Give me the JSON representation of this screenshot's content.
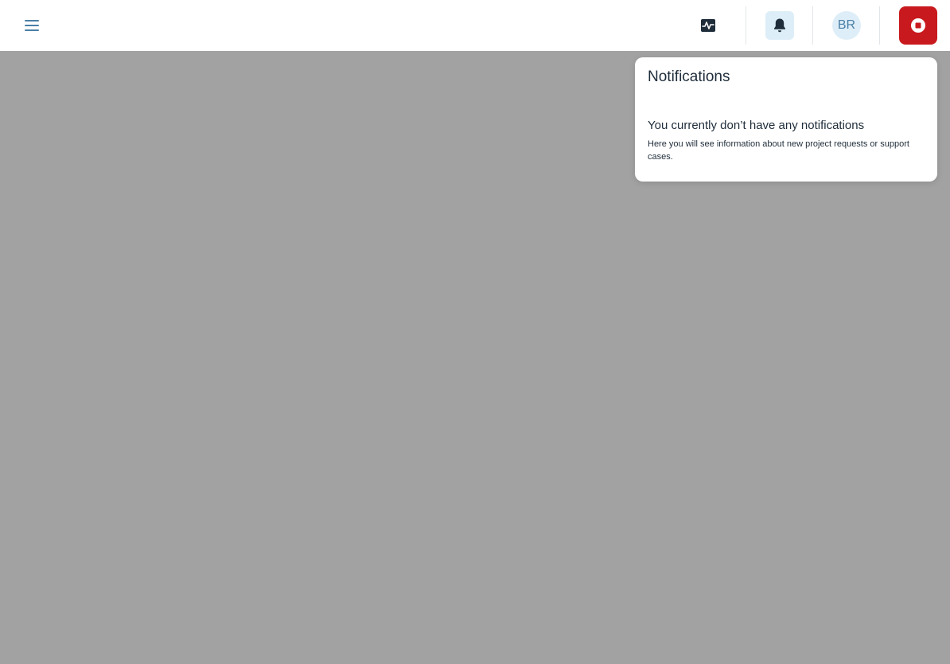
{
  "header": {
    "avatar_initials": "BR",
    "icons": {
      "menu": "hamburger-icon",
      "activity": "activity-chart-icon",
      "notifications": "bell-icon",
      "stop": "stop-record-icon"
    },
    "colors": {
      "accent": "#4a7fa6",
      "accent_bg": "#deeef8",
      "stop": "#c81a1e",
      "overlay": "#a2a2a2"
    }
  },
  "notifications": {
    "title": "Notifications",
    "empty_title": "You currently don’t have any notifications",
    "empty_description": "Here you will see information about new project requests or support cases."
  }
}
